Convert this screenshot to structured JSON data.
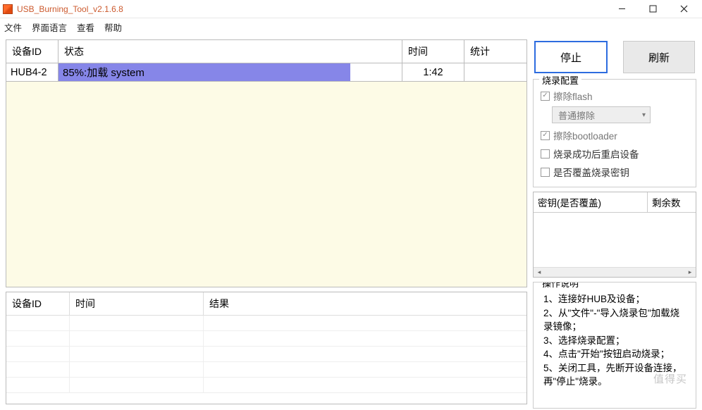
{
  "window": {
    "title": "USB_Burning_Tool_v2.1.6.8"
  },
  "menu": {
    "file": "文件",
    "language": "界面语言",
    "view": "查看",
    "help": "帮助"
  },
  "deviceTable": {
    "headers": {
      "id": "设备ID",
      "status": "状态",
      "time": "时间",
      "stats": "统计"
    },
    "row": {
      "id": "HUB4-2",
      "statusText": "85%:加载 system",
      "progressPercent": 85,
      "time": "1:42",
      "stats": ""
    }
  },
  "logTable": {
    "headers": {
      "id": "设备ID",
      "time": "时间",
      "result": "结果"
    }
  },
  "buttons": {
    "stop": "停止",
    "refresh": "刷新"
  },
  "config": {
    "title": "烧录配置",
    "eraseFlash": {
      "label": "擦除flash",
      "checked": true
    },
    "eraseMode": "普通擦除",
    "eraseBootloader": {
      "label": "擦除bootloader",
      "checked": true
    },
    "rebootAfter": {
      "label": "烧录成功后重启设备",
      "checked": false
    },
    "overwriteKey": {
      "label": "是否覆盖烧录密钥",
      "checked": false
    }
  },
  "keyTable": {
    "col1": "密钥(是否覆盖)",
    "col2": "剩余数"
  },
  "instructions": {
    "title": "操作说明",
    "lines": [
      "1、连接好HUB及设备；",
      "2、从\"文件\"-\"导入烧录包\"加载烧录镜像；",
      "3、选择烧录配置；",
      "4、点击\"开始\"按钮启动烧录；",
      "5、关闭工具，先断开设备连接，再\"停止\"烧录。"
    ]
  },
  "watermark": "值得买"
}
